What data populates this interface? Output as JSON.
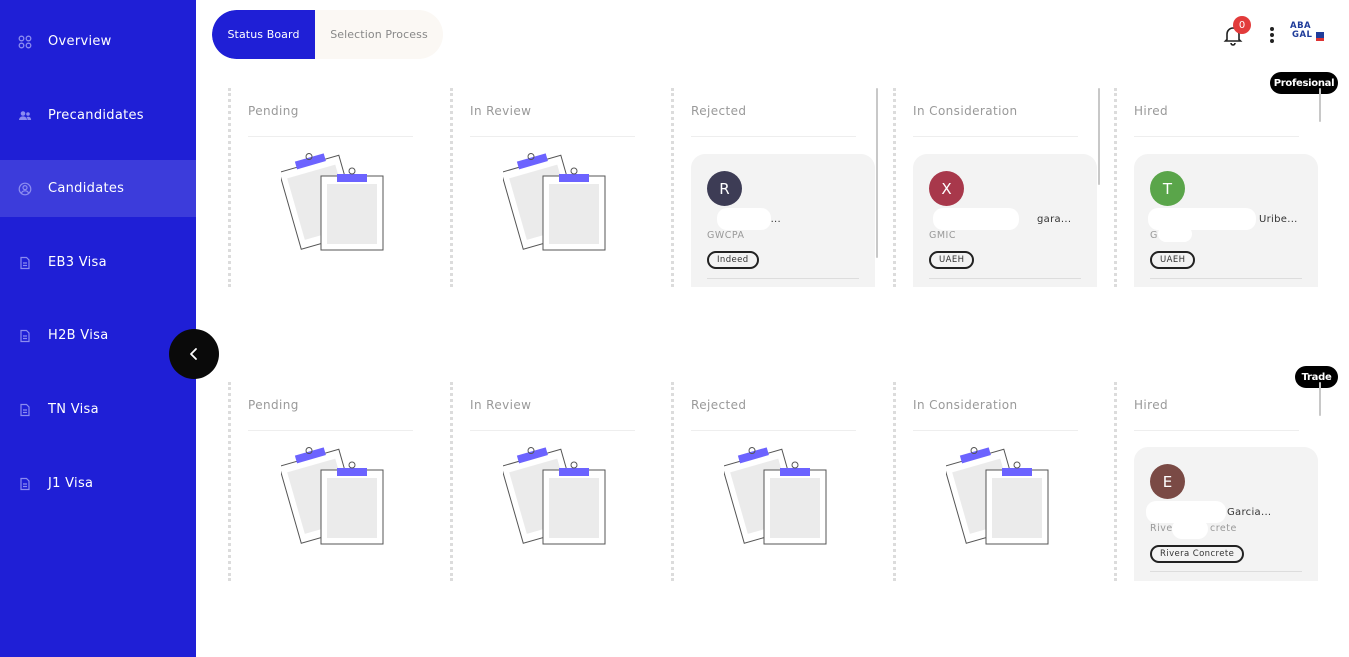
{
  "sidebar": {
    "items": [
      {
        "label": "Overview",
        "icon": "grid-icon"
      },
      {
        "label": "Precandidates",
        "icon": "users-icon"
      },
      {
        "label": "Candidates",
        "icon": "user-circle-icon",
        "active": true
      },
      {
        "label": "EB3 Visa",
        "icon": "document-icon"
      },
      {
        "label": "H2B Visa",
        "icon": "document-icon"
      },
      {
        "label": "TN Visa",
        "icon": "document-icon"
      },
      {
        "label": "J1 Visa",
        "icon": "document-icon"
      }
    ],
    "collapse_icon": "chevron-left-icon"
  },
  "tabs": [
    {
      "label": "Status Board",
      "active": true
    },
    {
      "label": "Selection Process",
      "active": false
    }
  ],
  "header": {
    "notifications_count": "0",
    "logo_text_line1": "ABA",
    "logo_text_line2": "GAL"
  },
  "boards": [
    {
      "tag": "Profesional",
      "columns": [
        {
          "title": "Pending"
        },
        {
          "title": "In Review"
        },
        {
          "title": "Rejected",
          "card": {
            "initial": "R",
            "name": "R...",
            "company": "GWCPA",
            "source": "Indeed",
            "color": "#3d3c55"
          }
        },
        {
          "title": "In Consideration",
          "card": {
            "initial": "X",
            "name": "gara...",
            "company": "GMIC",
            "source": "UAEH",
            "color": "#a8384b"
          }
        },
        {
          "title": "Hired",
          "card": {
            "initial": "T",
            "name": "Uribe...",
            "company": "G",
            "source": "UAEH",
            "color": "#5aa54a"
          }
        }
      ]
    },
    {
      "tag": "Trade",
      "columns": [
        {
          "title": "Pending"
        },
        {
          "title": "In Review"
        },
        {
          "title": "Rejected"
        },
        {
          "title": "In Consideration"
        },
        {
          "title": "Hired",
          "card": {
            "initial": "E",
            "name": "Garcia...",
            "company": "Rive",
            "company_tail": "crete",
            "source": "Rivera Concrete",
            "color": "#7a4a45"
          }
        }
      ]
    }
  ],
  "colors": {
    "primary": "#1f1fd6",
    "badge": "#e23b3b"
  }
}
